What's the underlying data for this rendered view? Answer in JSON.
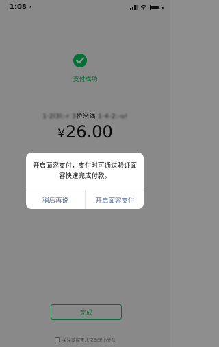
{
  "status_bar": {
    "time": "1:08",
    "location_icon": "location-arrow-icon",
    "icons": [
      "signal-icon",
      "wifi-icon",
      "battery-icon"
    ]
  },
  "result": {
    "icon": "check-circle-icon",
    "title": "支付成功",
    "merchant_obscured": "1·2l3l:-r 3",
    "merchant": "桥米线",
    "merchant_obscured_suffix": "1·4-2:-u!",
    "currency_symbol": "¥",
    "amount": "26.00"
  },
  "dialog": {
    "message": "开启面容支付，支付时可通过验证面容快速完成付款。",
    "secondary_label": "稍后再说",
    "primary_label": "开启面容支付"
  },
  "footer": {
    "done_label": "完成",
    "follow_text": "关注蒙妮宝北京珠玩小分队",
    "follow_checked": false
  },
  "colors": {
    "accent": "#07c160",
    "link": "#576b95",
    "background": "#ededed",
    "overlay": "rgba(0,0,0,0.42)"
  }
}
